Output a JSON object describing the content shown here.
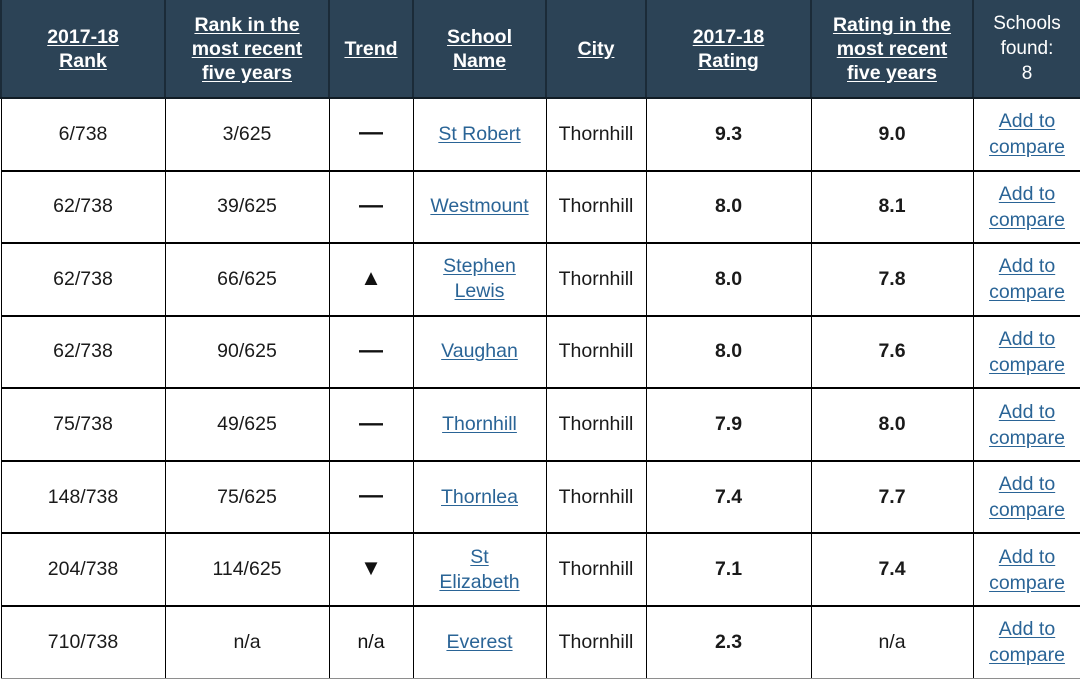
{
  "table": {
    "columns": [
      {
        "label": "2017-18 Rank",
        "lines": [
          "2017-18",
          "Rank"
        ],
        "sortable": true,
        "name": "col-rank-2017-18"
      },
      {
        "label": "Rank in the most recent five years",
        "lines": [
          "Rank in the",
          "most recent",
          "five years"
        ],
        "sortable": true,
        "name": "col-rank-five-years"
      },
      {
        "label": "Trend",
        "lines": [
          "Trend"
        ],
        "sortable": true,
        "name": "col-trend"
      },
      {
        "label": "School Name",
        "lines": [
          "School",
          "Name"
        ],
        "sortable": true,
        "name": "col-school-name"
      },
      {
        "label": "City",
        "lines": [
          "City"
        ],
        "sortable": true,
        "name": "col-city"
      },
      {
        "label": "2017-18 Rating",
        "lines": [
          "2017-18",
          "Rating"
        ],
        "sortable": true,
        "name": "col-rating-2017-18"
      },
      {
        "label": "Rating in the most recent five years",
        "lines": [
          "Rating in the",
          "most recent",
          "five years"
        ],
        "sortable": true,
        "name": "col-rating-five-years"
      },
      {
        "label": "Schools found: 8",
        "lines": [
          "Schools",
          "found:",
          "8"
        ],
        "sortable": false,
        "name": "col-schools-found"
      }
    ],
    "schools_found_count": "8",
    "compare_link_label": "Add to compare",
    "compare_link_line1": "Add to",
    "compare_link_line2": "compare",
    "trend_glyphs": {
      "flat": "—",
      "up": "▲",
      "down": "▼",
      "na": "n/a"
    },
    "rows": [
      {
        "rank_2017_18": "6/738",
        "rank_five_years": "3/625",
        "trend": "flat",
        "trend_text": "—",
        "school_name": "St Robert",
        "school_name_lines": [
          "St Robert"
        ],
        "city": "Thornhill",
        "rating_2017_18": "9.3",
        "rating_five_years": "9.0"
      },
      {
        "rank_2017_18": "62/738",
        "rank_five_years": "39/625",
        "trend": "flat",
        "trend_text": "—",
        "school_name": "Westmount",
        "school_name_lines": [
          "Westmount"
        ],
        "city": "Thornhill",
        "rating_2017_18": "8.0",
        "rating_five_years": "8.1"
      },
      {
        "rank_2017_18": "62/738",
        "rank_five_years": "66/625",
        "trend": "up",
        "trend_text": "▲",
        "school_name": "Stephen Lewis",
        "school_name_lines": [
          "Stephen",
          "Lewis"
        ],
        "city": "Thornhill",
        "rating_2017_18": "8.0",
        "rating_five_years": "7.8"
      },
      {
        "rank_2017_18": "62/738",
        "rank_five_years": "90/625",
        "trend": "flat",
        "trend_text": "—",
        "school_name": "Vaughan",
        "school_name_lines": [
          "Vaughan"
        ],
        "city": "Thornhill",
        "rating_2017_18": "8.0",
        "rating_five_years": "7.6"
      },
      {
        "rank_2017_18": "75/738",
        "rank_five_years": "49/625",
        "trend": "flat",
        "trend_text": "—",
        "school_name": "Thornhill",
        "school_name_lines": [
          "Thornhill"
        ],
        "city": "Thornhill",
        "rating_2017_18": "7.9",
        "rating_five_years": "8.0"
      },
      {
        "rank_2017_18": "148/738",
        "rank_five_years": "75/625",
        "trend": "flat",
        "trend_text": "—",
        "school_name": "Thornlea",
        "school_name_lines": [
          "Thornlea"
        ],
        "city": "Thornhill",
        "rating_2017_18": "7.4",
        "rating_five_years": "7.7"
      },
      {
        "rank_2017_18": "204/738",
        "rank_five_years": "114/625",
        "trend": "down",
        "trend_text": "▼",
        "school_name": "St Elizabeth",
        "school_name_lines": [
          "St",
          "Elizabeth"
        ],
        "city": "Thornhill",
        "rating_2017_18": "7.1",
        "rating_five_years": "7.4"
      },
      {
        "rank_2017_18": "710/738",
        "rank_five_years": "n/a",
        "trend": "na",
        "trend_text": "n/a",
        "school_name": "Everest",
        "school_name_lines": [
          "Everest"
        ],
        "city": "Thornhill",
        "rating_2017_18": "2.3",
        "rating_five_years": "n/a"
      }
    ]
  },
  "colors": {
    "header_background": "#2c4356",
    "header_text": "#ffffff",
    "link": "#2a6496",
    "cell_text": "#1a1a1a",
    "grid_line": "#000000",
    "page_background": "#ffffff"
  }
}
